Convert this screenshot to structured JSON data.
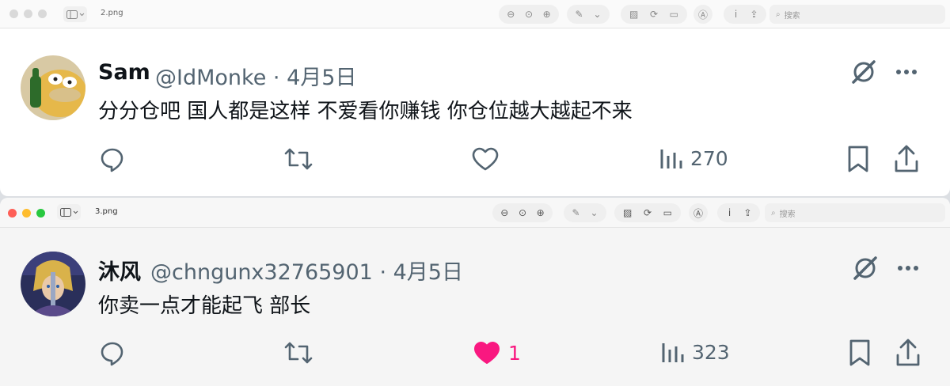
{
  "window1": {
    "filename": "2.png",
    "search_placeholder": "搜索",
    "tweet": {
      "display_name": "Sam",
      "handle": "@IdMonke",
      "separator": "·",
      "date": "4月5日",
      "text": "分分仓吧 国人都是这样 不爱看你赚钱 你仓位越大越起不来",
      "views": "270"
    }
  },
  "window2": {
    "filename": "3.png",
    "search_placeholder": "搜索",
    "tweet": {
      "display_name": "沐风",
      "handle": "@chngunx32765901",
      "separator": "·",
      "date": "4月5日",
      "text": "你卖一点才能起飞 部长",
      "likes": "1",
      "views": "323"
    }
  },
  "colors": {
    "like_active": "#f91880",
    "text_secondary": "#536471",
    "text_primary": "#0f1419"
  }
}
